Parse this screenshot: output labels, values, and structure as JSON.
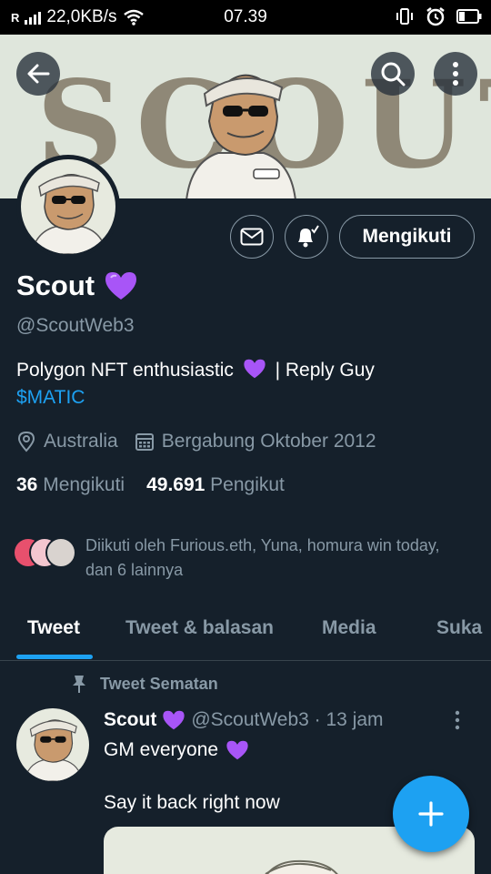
{
  "statusbar": {
    "signal_label": "R",
    "speed": "22,0KB/s",
    "time": "07.39"
  },
  "banner": {
    "word": "SCOUT"
  },
  "actions": {
    "follow_label": "Mengikuti"
  },
  "profile": {
    "name": "Scout",
    "name_emoji": "purple-heart",
    "handle": "@ScoutWeb3",
    "bio_text": "Polygon NFT enthusiastic",
    "bio_after_heart": "| Reply Guy",
    "bio_cashtag": "$MATIC",
    "location": "Australia",
    "joined": "Bergabung Oktober 2012",
    "following_count": "36",
    "following_label": "Mengikuti",
    "followers_count": "49.691",
    "followers_label": "Pengikut",
    "followed_by": "Diikuti oleh Furious.eth, Yuna, homura win today, dan 6 lainnya"
  },
  "tabs": [
    {
      "label": "Tweet",
      "active": true
    },
    {
      "label": "Tweet & balasan",
      "active": false
    },
    {
      "label": "Media",
      "active": false
    },
    {
      "label": "Suka",
      "active": false
    }
  ],
  "pinned": {
    "label": "Tweet Sematan"
  },
  "tweet": {
    "author": "Scout",
    "handle_time": "@ScoutWeb3 · 13 jam",
    "line1": "GM everyone",
    "line2": "Say it back right now"
  },
  "icons": {
    "back": "back-arrow-icon",
    "search": "search-icon",
    "more": "more-vertical-icon",
    "mail": "mail-icon",
    "bell": "notification-bell-icon",
    "location": "location-pin-icon",
    "calendar": "calendar-icon",
    "pin": "pin-icon",
    "compose": "plus-icon",
    "heart": "purple-heart-icon"
  },
  "colors": {
    "background": "#15202b",
    "accent": "#1da1f2",
    "muted": "#8899a6",
    "heart": "#a855f7"
  }
}
